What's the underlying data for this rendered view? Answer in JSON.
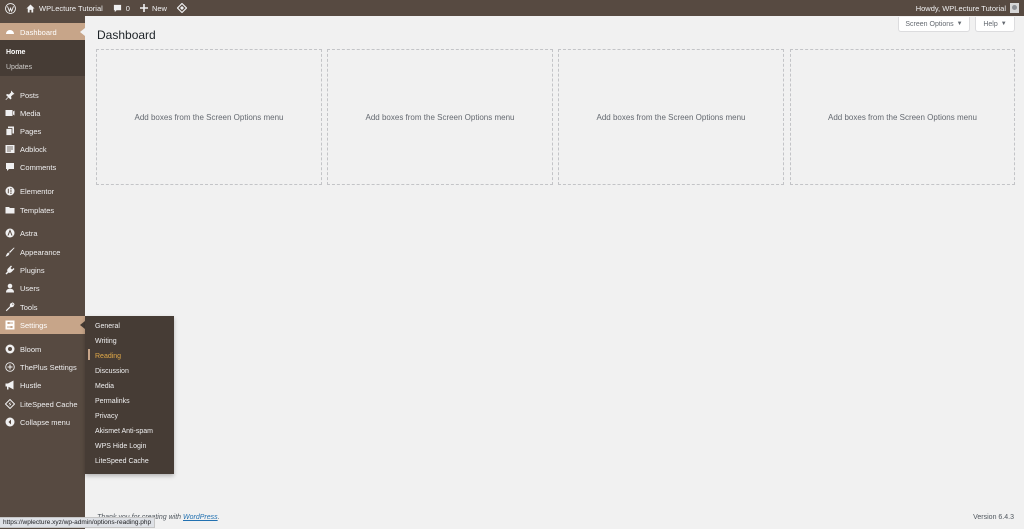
{
  "adminbar": {
    "site_name": "WPLecture Tutorial",
    "comments_count": "0",
    "new_label": "New",
    "howdy": "Howdy, WPLecture Tutorial"
  },
  "sidebar": {
    "dashboard": "Dashboard",
    "submenu": [
      "Home",
      "Updates"
    ],
    "items": [
      "Posts",
      "Media",
      "Pages",
      "Adblock",
      "Comments",
      "Elementor",
      "Templates",
      "Astra",
      "Appearance",
      "Plugins",
      "Users",
      "Tools",
      "Settings",
      "Bloom",
      "ThePlus Settings",
      "Hustle",
      "LiteSpeed Cache",
      "Collapse menu"
    ]
  },
  "settings_flyout": [
    "General",
    "Writing",
    "Reading",
    "Discussion",
    "Media",
    "Permalinks",
    "Privacy",
    "Akismet Anti-spam",
    "WPS Hide Login",
    "LiteSpeed Cache"
  ],
  "header": {
    "screen_options": "Screen Options",
    "help": "Help",
    "title": "Dashboard"
  },
  "boxes": [
    "Add boxes from the Screen Options menu",
    "Add boxes from the Screen Options menu",
    "Add boxes from the Screen Options menu",
    "Add boxes from the Screen Options menu"
  ],
  "footer": {
    "thanks_prefix": "Thank you for creating with ",
    "thanks_link": "WordPress",
    "thanks_suffix": ".",
    "version": "Version 6.4.3"
  },
  "statusbar": {
    "url": "https://wplecture.xyz/wp-admin/options-reading.php"
  },
  "colors": {
    "menu_bg": "#574a41",
    "submenu_bg": "#463c35",
    "accent": "#c7a589",
    "current_sub": "#e1a948"
  }
}
